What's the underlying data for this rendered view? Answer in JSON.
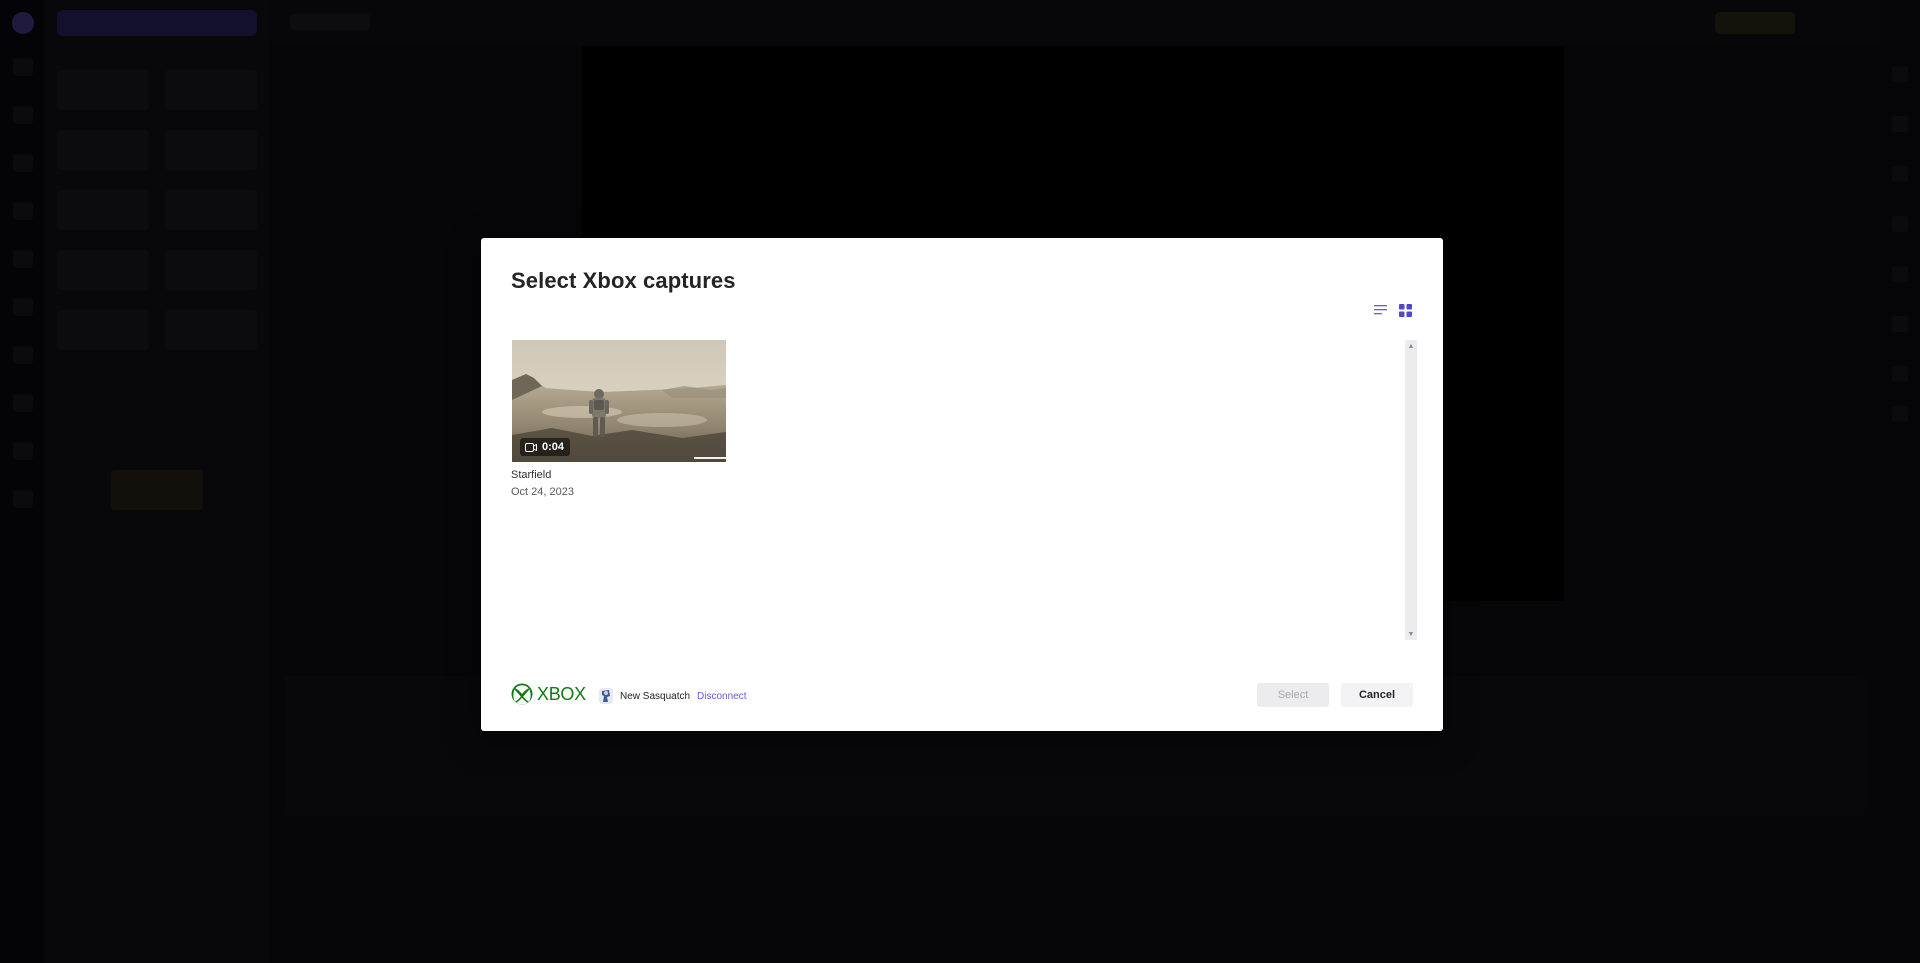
{
  "modal": {
    "title": "Select Xbox captures",
    "view_toggle": {
      "list_icon": "list-view-icon",
      "grid_icon": "grid-view-icon",
      "active": "grid"
    },
    "captures": [
      {
        "title": "Starfield",
        "date": "Oct 24, 2023",
        "duration": "0:04",
        "type_icon": "video-camera-icon"
      }
    ],
    "footer": {
      "brand": "XBOX",
      "brand_icon": "xbox-logo-icon",
      "gamertag": "New Sasquatch",
      "disconnect_label": "Disconnect",
      "select_label": "Select",
      "cancel_label": "Cancel"
    }
  },
  "colors": {
    "xbox_green": "#107c10",
    "accent_purple": "#6b5bd6"
  }
}
